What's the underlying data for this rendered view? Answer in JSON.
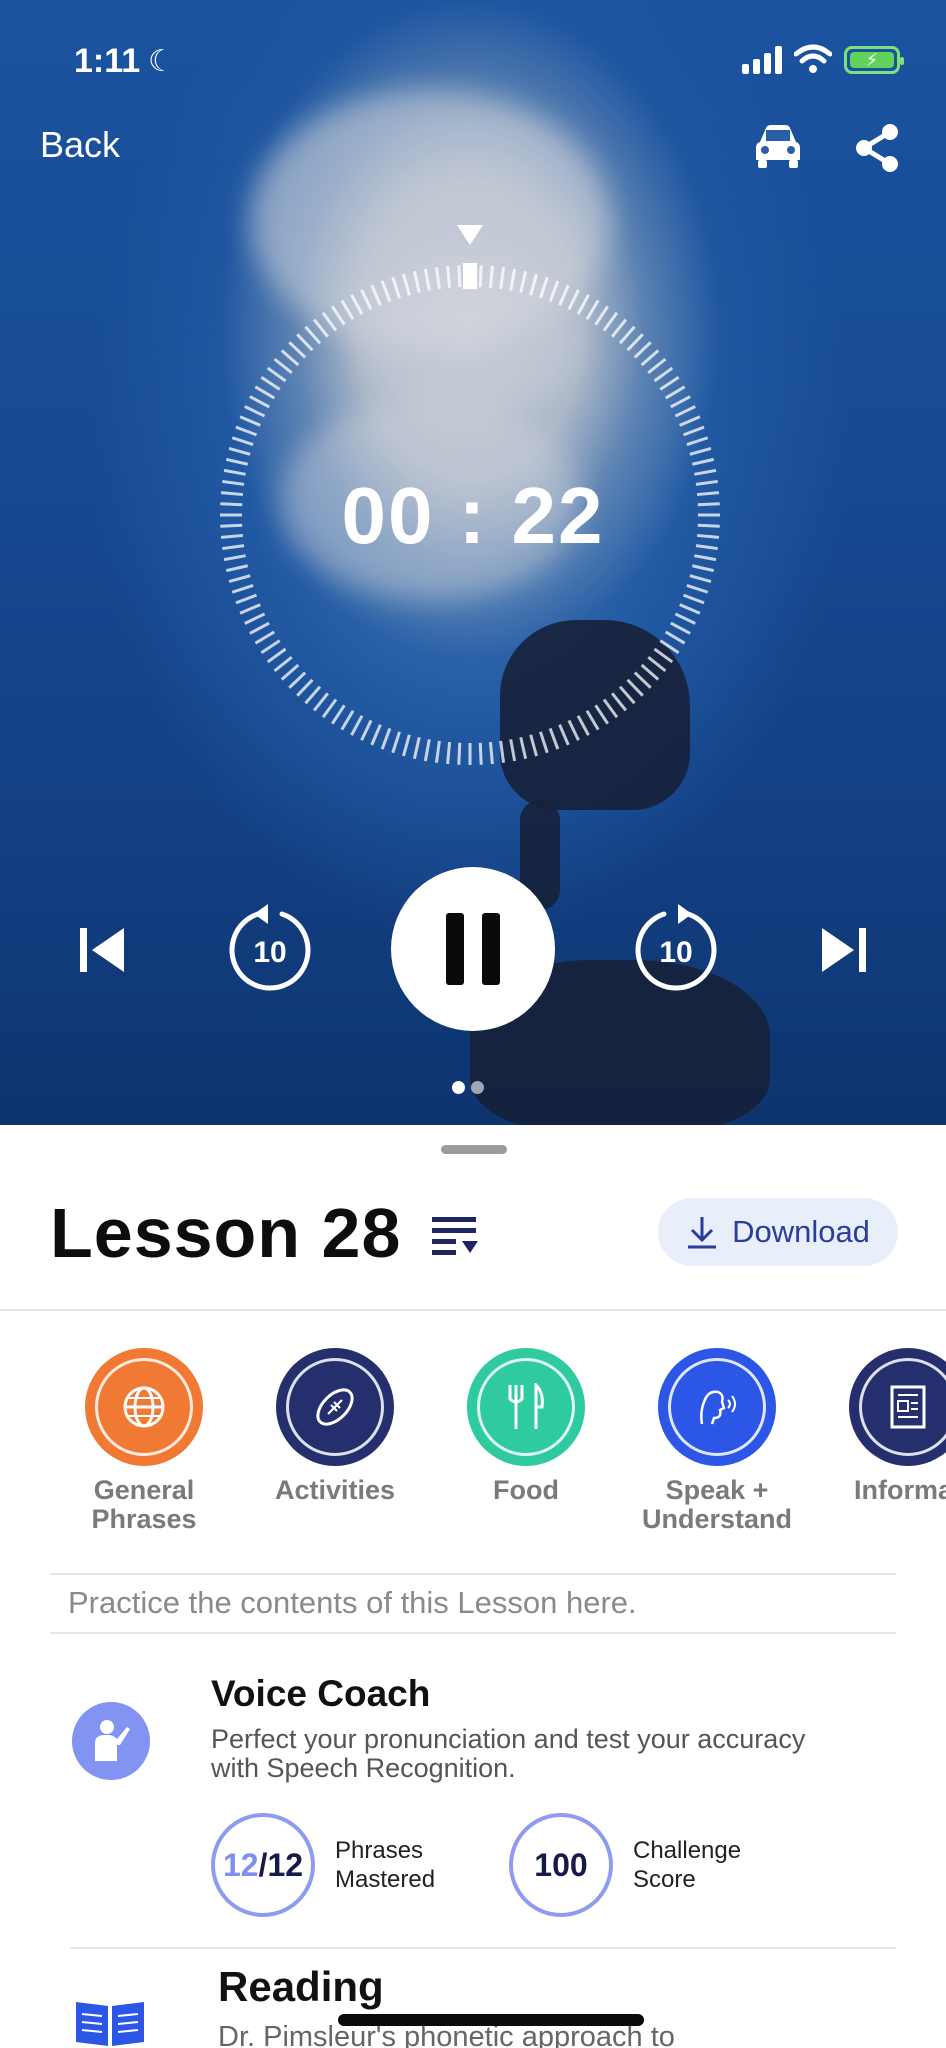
{
  "status_bar": {
    "time": "1:11",
    "moon_glyph": "☾",
    "battery_glyph": "⚡",
    "icons": [
      "signal-icon",
      "wifi-icon",
      "battery-charging-icon"
    ]
  },
  "header": {
    "back_label": "Back",
    "icons": [
      "car-icon",
      "share-icon"
    ]
  },
  "player": {
    "timer": "00 : 22",
    "rewind_seconds": "10",
    "forward_seconds": "10",
    "state": "playing",
    "page_count": 2,
    "active_page": 0
  },
  "lesson": {
    "title": "Lesson 28",
    "download_label": "Download"
  },
  "categories": [
    {
      "label": "General\nPhrases",
      "color": "#f07a34",
      "icon": "globe-icon"
    },
    {
      "label": "Activities",
      "color": "#262f6e",
      "icon": "football-icon"
    },
    {
      "label": "Food",
      "color": "#2fcaa0",
      "icon": "utensils-icon"
    },
    {
      "label": "Speak +\nUnderstand",
      "color": "#2b56e6",
      "icon": "speaking-head-icon"
    },
    {
      "label": "Informat",
      "color": "#262f6e",
      "icon": "newspaper-icon"
    }
  ],
  "practice": {
    "hint": "Practice the contents of this Lesson here."
  },
  "voice_coach": {
    "title": "Voice Coach",
    "description": "Perfect your pronunciation and test your accuracy with Speech Recognition.",
    "phrases_done": "12",
    "phrases_sep": "/",
    "phrases_total": "12",
    "phrases_label": "Phrases Mastered",
    "challenge_score": "100",
    "challenge_label": "Challenge Score"
  },
  "reading": {
    "title": "Reading",
    "description": "Dr. Pimsleur's phonetic approach to"
  },
  "colors": {
    "accent": "#2a3c9c",
    "download_bg": "#e9eefb",
    "ring": "#8f9bf0"
  }
}
